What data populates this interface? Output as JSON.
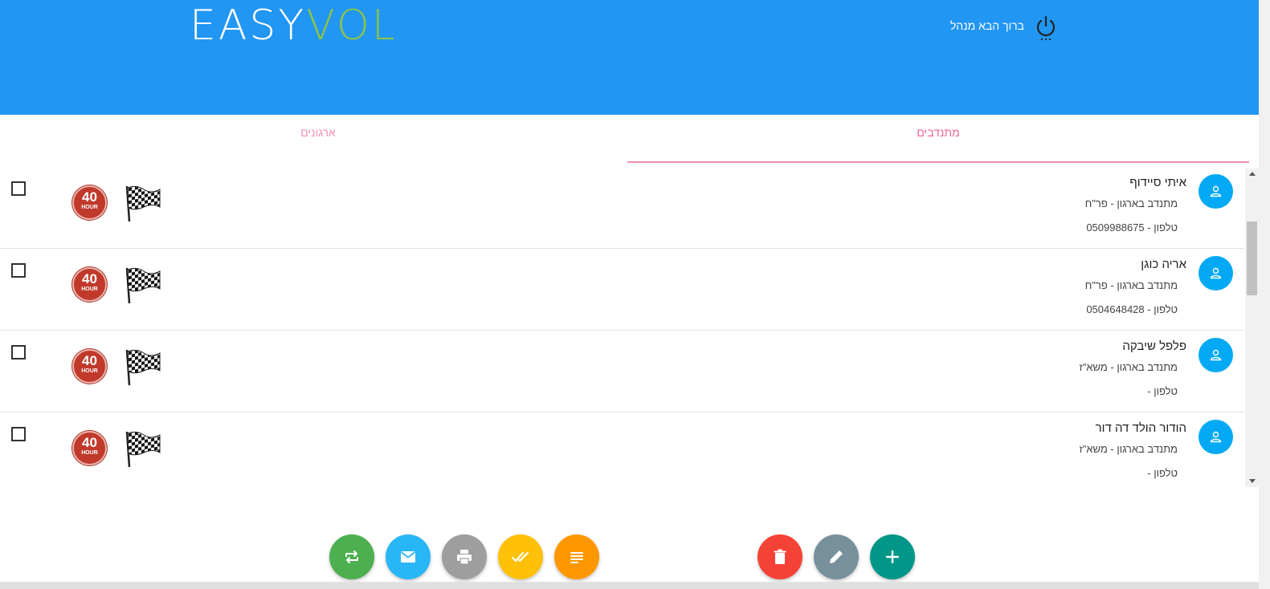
{
  "header": {
    "logo_part1": "EASY",
    "logo_part2": "VOL",
    "welcome": "ברוך הבא מנהל",
    "bg_color": "#2196f3",
    "power_icon": "power-icon"
  },
  "tabs": [
    {
      "label": "מתנדבים",
      "active": true
    },
    {
      "label": "ארגונים",
      "active": false
    }
  ],
  "volunteers": [
    {
      "name": "איתי סיידוף",
      "org": "מתנדב בארגון - פר\"ח",
      "phone": "טלפון - 0509988675",
      "badge_number": "40",
      "badge_text": "HOUR"
    },
    {
      "name": "אריה כוגן",
      "org": "מתנדב בארגון - פר\"ח",
      "phone": "טלפון - 0504648428",
      "badge_number": "40",
      "badge_text": "HOUR"
    },
    {
      "name": "פלפל שיבקה",
      "org": "מתנדב בארגון - משא\"ז",
      "phone": "טלפון -",
      "badge_number": "40",
      "badge_text": "HOUR"
    },
    {
      "name": "הודור הולד דה דור",
      "org": "מתנדב בארגון - משא\"ז",
      "phone": "טלפון -",
      "badge_number": "40",
      "badge_text": "HOUR"
    }
  ],
  "actions": [
    {
      "name": "transfer",
      "icon": "swap-icon",
      "color": "#4caf50"
    },
    {
      "name": "email",
      "icon": "mail-icon",
      "color": "#29b6f6"
    },
    {
      "name": "print",
      "icon": "print-icon",
      "color": "#9e9e9e"
    },
    {
      "name": "approve",
      "icon": "double-check-icon",
      "color": "#ffc107"
    },
    {
      "name": "notes",
      "icon": "notes-icon",
      "color": "#ff9800"
    },
    {
      "name": "delete",
      "icon": "trash-icon",
      "color": "#f44336"
    },
    {
      "name": "edit",
      "icon": "pencil-icon",
      "color": "#78909c"
    },
    {
      "name": "add",
      "icon": "plus-icon",
      "color": "#009688"
    }
  ]
}
